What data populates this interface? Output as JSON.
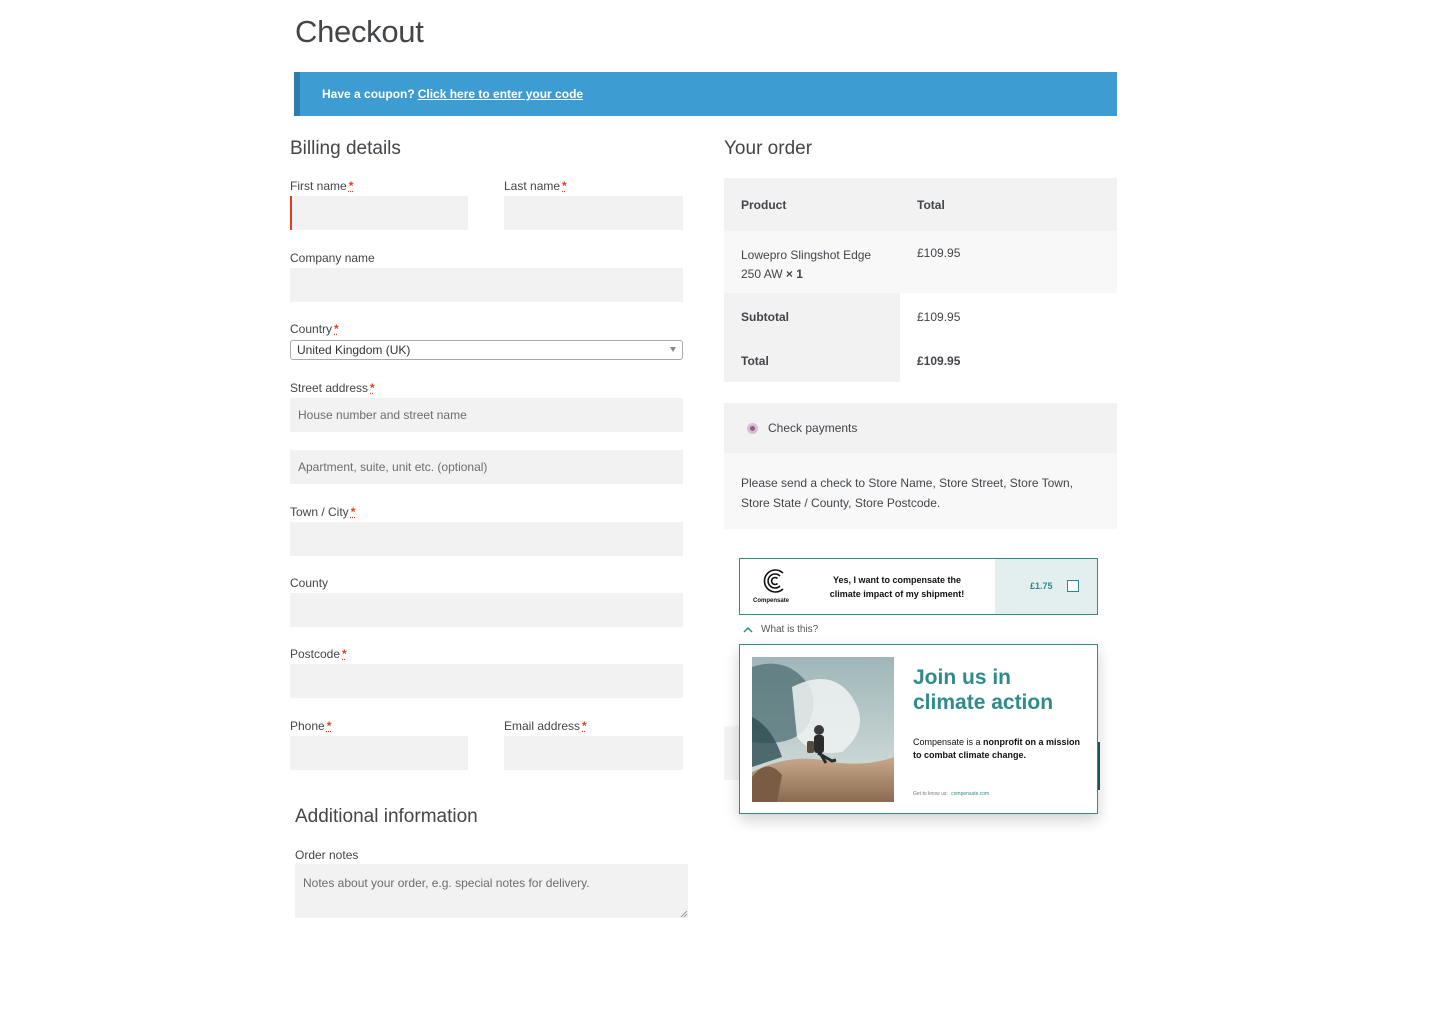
{
  "page": {
    "title": "Checkout"
  },
  "coupon": {
    "prompt": "Have a coupon?",
    "link": "Click here to enter your code",
    "color": "#3d9cd2"
  },
  "billing": {
    "heading": "Billing details",
    "required_mark": "*",
    "first_name": {
      "label": "First name",
      "value": ""
    },
    "last_name": {
      "label": "Last name",
      "value": ""
    },
    "company": {
      "label": "Company name",
      "value": ""
    },
    "country": {
      "label": "Country",
      "selected": "United Kingdom (UK)"
    },
    "street": {
      "label": "Street address",
      "placeholder1": "House number and street name",
      "placeholder2": "Apartment, suite, unit etc. (optional)"
    },
    "town": {
      "label": "Town / City",
      "value": ""
    },
    "county": {
      "label": "County",
      "value": ""
    },
    "postcode": {
      "label": "Postcode",
      "value": ""
    },
    "phone": {
      "label": "Phone",
      "value": ""
    },
    "email": {
      "label": "Email address",
      "value": ""
    }
  },
  "additional": {
    "heading": "Additional information",
    "notes_label": "Order notes",
    "notes_placeholder": "Notes about your order, e.g. special notes for delivery."
  },
  "order": {
    "heading": "Your order",
    "col_product": "Product",
    "col_total": "Total",
    "item_name_line1": "Lowepro Slingshot Edge",
    "item_name_line2": "250 AW",
    "item_qty": "× 1",
    "item_total": "£109.95",
    "subtotal_label": "Subtotal",
    "subtotal_value": "£109.95",
    "total_label": "Total",
    "total_value": "£109.95"
  },
  "payment": {
    "method": "Check payments",
    "description": "Please send a check to Store Name, Store Street, Store Town, Store State / County, Store Postcode.",
    "accent": "#96588a"
  },
  "compensate": {
    "brand": "Compensate",
    "offer_line1": "Yes, I want to compensate the",
    "offer_line2": "climate impact of my shipment!",
    "price": "£1.75",
    "what_is_this": "What is this?",
    "card_title_line1": "Join us in",
    "card_title_line2": "climate action",
    "card_text_a": "Compensate is a ",
    "card_text_bold": "nonprofit on a mission to combat climate change.",
    "card_link_prefix": "Get to know us:",
    "card_link": "compensate.com",
    "accent": "#2e8b8b"
  }
}
